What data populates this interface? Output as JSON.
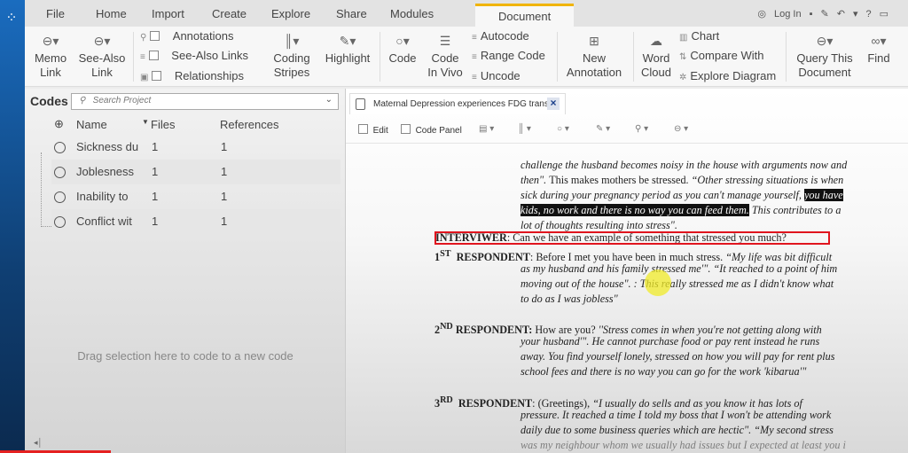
{
  "menu": {
    "tabs": [
      "File",
      "Home",
      "Import",
      "Create",
      "Explore",
      "Share",
      "Modules",
      "Document"
    ],
    "active_tab": "Document",
    "quick_access": {
      "login": "Log In",
      "help": "?"
    }
  },
  "ribbon": {
    "memo_link": "Memo Link",
    "see_also_link": "See-Also Link",
    "annotations": "Annotations",
    "see_also_links": "See-Also Links",
    "relationships": "Relationships",
    "coding_stripes": "Coding Stripes",
    "highlight": "Highlight",
    "code": "Code",
    "code_in_vivo": "Code In Vivo",
    "autocode": "Autocode",
    "range_code": "Range Code",
    "uncode": "Uncode",
    "new_annotation": "New Annotation",
    "word_cloud": "Word Cloud",
    "chart": "Chart",
    "compare_with": "Compare With",
    "explore_diagram": "Explore Diagram",
    "query_this_document": "Query This Document",
    "find": "Find"
  },
  "codes_panel": {
    "title": "Codes",
    "search_placeholder": "Search Project",
    "columns": {
      "name": "Name",
      "files": "Files",
      "references": "References"
    },
    "rows": [
      {
        "name": "Sickness du",
        "files": "1",
        "references": "1"
      },
      {
        "name": "Joblesness",
        "files": "1",
        "references": "1"
      },
      {
        "name": "Inability to",
        "files": "1",
        "references": "1"
      },
      {
        "name": "Conflict wit",
        "files": "1",
        "references": "1"
      }
    ],
    "drag_hint": "Drag selection here to code to a new code"
  },
  "document": {
    "tab_title": "Maternal Depression experiences FDG transcri",
    "toolbar": {
      "edit": "Edit",
      "code_panel": "Code Panel"
    },
    "lines": {
      "p1_l1": "challenge the husband becomes noisy in the house with arguments now and",
      "p1_l2a": "then\". ",
      "p1_l2b": "This makes mothers be stressed. ",
      "p1_l2c": "“Other stressing situations is when",
      "p1_l3a": "sick during your pregnancy period as you can't manage yourself, ",
      "p1_l3b": "you have",
      "p1_l4a": "kids, no work and there is no way you can feed them.",
      "p1_l4b": " This contributes to a",
      "p1_l5": "lot of thoughts resulting into stress\".",
      "interviewer_label": "INTERVIWER",
      "interviewer_text": ": Can we have an example of something that stressed you much?",
      "r1_num": "1",
      "r1_sup": "ST",
      "r1_label": "RESPONDENT",
      "r1_l1a": ": Before I met you have been in much stress. ",
      "r1_l1b": "“My life was bit difficult",
      "r1_l2": "as my husband and his family stressed me'\". “It reached to a point of him",
      "r1_l3": "moving out of the house\". : This really stressed me as I didn't know what",
      "r1_l4": "to do as I was jobless\"",
      "r2_num": "2",
      "r2_sup": "ND",
      "r2_label": "RESPONDENT:",
      "r2_l1a": " How are you? ",
      "r2_l1b": "''Stress comes in when you're not getting along with",
      "r2_l2": "your husband'\". He cannot purchase food or pay rent instead he runs",
      "r2_l3": "away. You find yourself lonely, stressed on how you will pay for rent plus",
      "r2_l4": "school fees and there is no way you can go for the work 'kibarua'\"",
      "r3_num": "3",
      "r3_sup": "RD",
      "r3_label": "RESPONDENT",
      "r3_l1a": ": (Greetings), ",
      "r3_l1b": "“I usually do sells and as you know it has lots of",
      "r3_l2": "pressure. It reached a time I told my boss that I won't be attending work",
      "r3_l3": "daily due to some business queries which are hectic\". “My second stress",
      "r3_l4": "was my neighbour whom we usually had issues but I expected at least you i"
    }
  },
  "colors": {
    "accent_tab": "#f0b400",
    "sidebar": "#1a6cbf",
    "annotation_box": "#e0141e"
  }
}
